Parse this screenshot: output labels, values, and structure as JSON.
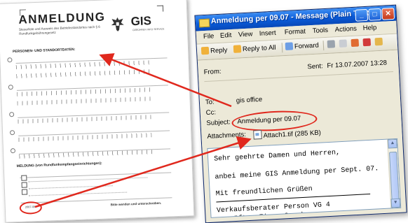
{
  "form": {
    "title": "ANMELDUNG",
    "subtitle": "Steuerliste und Ausweis des Betriebsstandortes nach § 6 Rundfunkgebührengesetz",
    "logo": "GIS",
    "logo_sub": "GEBÜHREN INFO SERVICE",
    "section_personal": "PERSONEN- UND STANDORTDATEN:",
    "section_meldung": "MELDUNG (von Rundfunkempfangseinrichtungen):",
    "footer_note": "Bitte wenden und unterschreiben.",
    "date_field": "2007-08"
  },
  "window": {
    "title": "Anmeldung per 09.07 - Message (Plain Text)",
    "menu": [
      "File",
      "Edit",
      "View",
      "Insert",
      "Format",
      "Tools",
      "Actions",
      "Help"
    ],
    "toolbar": {
      "reply": "Reply",
      "reply_all": "Reply to All",
      "forward": "Forward"
    },
    "header": {
      "from_label": "From:",
      "sent_label": "Sent:",
      "sent_value": "Fr 13.07.2007 13:28",
      "to_label": "To:",
      "to_value": "gis office",
      "cc_label": "Cc:",
      "subject_label": "Subject:",
      "subject_value": "Anmeldung per 09.07",
      "attachments_label": "Attachments:",
      "attachment_name": "Attach1.tif",
      "attachment_size": "(285 KB)"
    },
    "body_lines": [
      "Sehr geehrte Damen und Herren,",
      "anbei meine GIS Anmeldung per Sept. 07.",
      "Mit freundlichen Grüßen",
      "Verkaufsberater Person VG 4",
      "geprüfter FinanzCoach"
    ]
  },
  "colors": {
    "annotation": "#e0281d",
    "titlebar": "#0a5bd8"
  }
}
